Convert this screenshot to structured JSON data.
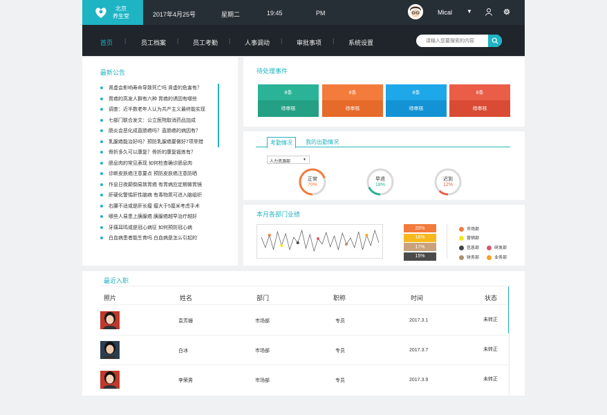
{
  "header": {
    "logo_line1": "北京",
    "logo_line2": "养生堂",
    "date": "2017年4月25号",
    "weekday": "星期二",
    "time": "19:45",
    "ampm": "PM",
    "username": "Mical",
    "dropdown_glyph": "▼"
  },
  "nav": {
    "items": [
      "首页",
      "员工档案",
      "员工考勤",
      "人事调动",
      "审批事项",
      "系统设置"
    ],
    "separator": "|",
    "search_placeholder": "请输入您要搜索的内容"
  },
  "notice": {
    "title": "最新公告",
    "items": [
      "肾虚会影响寿命导致死亡吗 肾虚的危害有？",
      "胃癌的高发人群有六种 胃癌的诱因有哪些",
      "调查：近半数老年人认为共产主义最终能实现",
      "七部门联合发文：公立医院取消药品加成",
      "肠炎会恶化成直肠癌吗？直肠癌的病因有？",
      "乳腺癌能治好吗？预防乳腺癌要做好7项举措",
      "骨折多久可以康复？骨折的康复锻炼有？",
      "肠息肉的常见表现 如何检查确诊肠息肉",
      "诊断皮肤癌注意要点 预防皮肤癌注意防晒",
      "作息日夜颠倒易致胃癌 有胃病应定期做胃镜",
      "肝硬化警惕肝性脑病 有毒物质可进入脑组织",
      "右腰不适或是肝长瘤 瘤大于5厘米考虑手术",
      "哪些人易患上胰腺癌 胰腺癌越早治疗越好",
      "牙痛耳鸣或是冠心病征 如何预防冠心病",
      "白血病患者能生育吗 白血病是怎么引起的"
    ]
  },
  "pending": {
    "title": "待处理事件",
    "cards": [
      {
        "count": "8条",
        "label": "待审核",
        "color": "#2bb397",
        "dark": "#24a084"
      },
      {
        "count": "8条",
        "label": "待审核",
        "color": "#f37b3b",
        "dark": "#e66a29"
      },
      {
        "count": "8条",
        "label": "待审核",
        "color": "#1ea7e9",
        "dark": "#1393d3"
      },
      {
        "count": "8条",
        "label": "待审核",
        "color": "#ea5d47",
        "dark": "#d94b35"
      }
    ]
  },
  "attendance": {
    "tab_active": "考勤情况",
    "tab_other": "我的出勤情况",
    "dept": "人力资源部",
    "dept_arrow": "▼",
    "gauges": [
      {
        "label": "正常",
        "value": "70%",
        "fraction": 0.7,
        "color": "#f37b3b"
      },
      {
        "label": "早退",
        "value": "18%",
        "fraction": 0.18,
        "color": "#2bb397"
      },
      {
        "label": "迟到",
        "value": "12%",
        "fraction": 0.12,
        "color": "#ea5d47"
      }
    ]
  },
  "performance": {
    "title": "本月各部门业绩",
    "bars": [
      {
        "value": "20%",
        "color": "#f37b3b"
      },
      {
        "value": "16%",
        "color": "#f6b91d"
      },
      {
        "value": "17%",
        "color": "#c8a27a"
      },
      {
        "value": "15%",
        "color": "#4a4a4a"
      }
    ],
    "legend": [
      {
        "label": "市场部",
        "color": "#f37b3b"
      },
      {
        "label": "营销部",
        "color": "#f5e617"
      },
      {
        "label": "信息部",
        "color": "#444444"
      },
      {
        "label": "研发部",
        "color": "#d6586f"
      },
      {
        "label": "财务部",
        "color": "#b08d6e"
      },
      {
        "label": "业务部",
        "color": "#f6a21d"
      }
    ],
    "line_values": [
      30,
      15,
      33,
      12,
      38,
      18,
      35,
      12,
      30,
      22,
      40,
      14,
      34,
      10,
      28,
      20,
      37,
      16,
      32,
      12,
      36,
      20,
      29,
      15,
      38,
      12,
      33,
      18,
      40,
      22
    ]
  },
  "recent": {
    "title": "最近入职",
    "headers": [
      "照片",
      "姓名",
      "部门",
      "职称",
      "时间",
      "状态"
    ],
    "rows": [
      {
        "name": "袁芳姗",
        "dept": "市场部",
        "title": "专员",
        "date": "2017.3.1",
        "status": "未转正"
      },
      {
        "name": "白冰",
        "dept": "市场部",
        "title": "专员",
        "date": "2017.3.7",
        "status": "未转正"
      },
      {
        "name": "李荣男",
        "dept": "市场部",
        "title": "专员",
        "date": "2017.3.9",
        "status": "未转正"
      }
    ]
  }
}
